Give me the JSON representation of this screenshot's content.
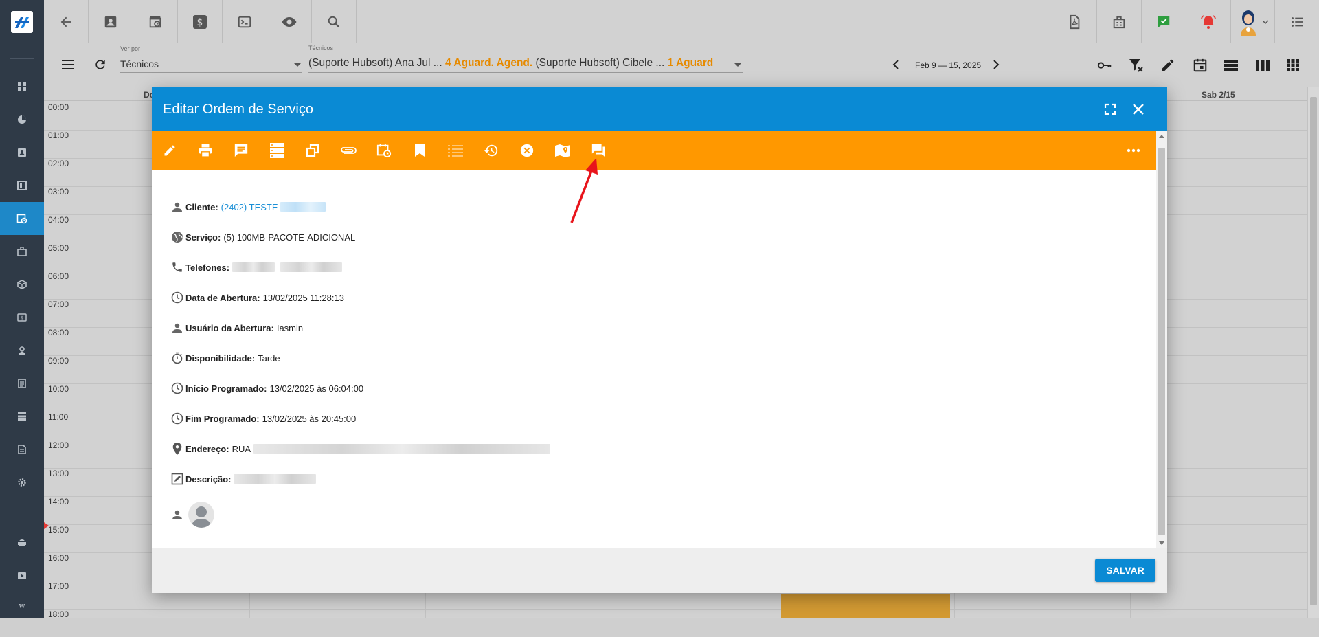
{
  "toolbar": {
    "view_by_label": "Ver por",
    "view_by_value": "Técnicos",
    "techs_label": "Técnicos",
    "tech1": "(Suporte Hubsoft) Ana Jul ...",
    "tech1_status": "4 Aguard. Agend.",
    "tech2": "(Suporte Hubsoft) Cibele ...",
    "tech2_status": "1 Aguard",
    "date_range": "Feb 9 — 15, 2025"
  },
  "calendar": {
    "first_day_label": "Do",
    "last_day_label": "Sab 2/15",
    "hours": [
      "00:00",
      "01:00",
      "02:00",
      "03:00",
      "04:00",
      "05:00",
      "06:00",
      "07:00",
      "08:00",
      "09:00",
      "10:00",
      "11:00",
      "12:00",
      "13:00",
      "14:00",
      "15:00",
      "16:00",
      "17:00",
      "18:00"
    ]
  },
  "modal": {
    "title": "Editar Ordem de Serviço",
    "fields": {
      "cliente_label": "Cliente:",
      "cliente_value": "(2402) TESTE",
      "servico_label": "Serviço:",
      "servico_value": "(5) 100MB-PACOTE-ADICIONAL",
      "telefones_label": "Telefones:",
      "abertura_label": "Data de Abertura:",
      "abertura_value": "13/02/2025 11:28:13",
      "usuario_label": "Usuário da Abertura:",
      "usuario_value": "Iasmin",
      "disponibilidade_label": "Disponibilidade:",
      "disponibilidade_value": "Tarde",
      "inicio_label": "Início Programado:",
      "inicio_value": "13/02/2025 às 06:04:00",
      "fim_label": "Fim Programado:",
      "fim_value": "13/02/2025 às 20:45:00",
      "endereco_label": "Endereço:",
      "endereco_value": "RUA",
      "descricao_label": "Descrição:"
    },
    "save_label": "SALVAR"
  },
  "colors": {
    "header_blue": "#0a8ad4",
    "toolbar_orange": "#ff9800",
    "sidebar": "#2f3a47",
    "status_orange": "#e68a00"
  }
}
